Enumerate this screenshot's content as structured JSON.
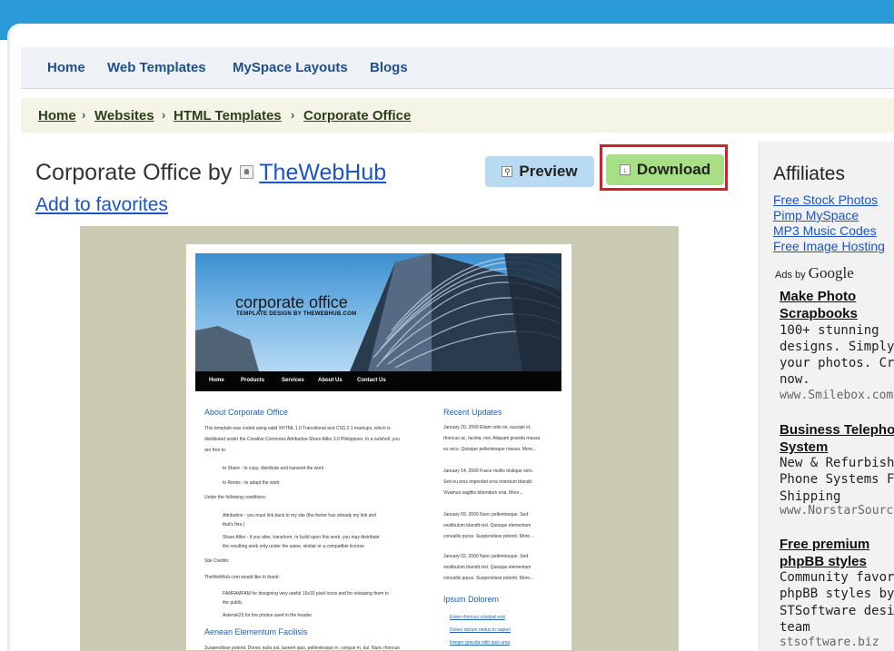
{
  "nav": {
    "items": [
      "Home",
      "Web Templates",
      "MySpace Layouts",
      "Blogs"
    ]
  },
  "breadcrumb": {
    "items": [
      "Home",
      "Websites",
      "HTML Templates",
      "Corporate Office"
    ],
    "separator": "›"
  },
  "page": {
    "title_prefix": "Corporate Office by",
    "author": "TheWebHub",
    "favorites": "Add to favorites",
    "preview_label": "Preview",
    "download_label": "Download"
  },
  "preview": {
    "banner_title": "corporate office",
    "banner_sub": "TEMPLATE DESIGN BY THEWEBHUB.COM",
    "menu": [
      "Home",
      "Products",
      "Services",
      "About Us",
      "Contact Us"
    ],
    "about_heading": "About Corporate Office",
    "about_lines": [
      "This template was coded using valid XHTML 1.0 Transitional and CSS 2.1 markups, which is",
      "distributed under the Creative Commons Attribution-Share Alike 3.0 Philippines. In a nutshell, you",
      "are free to:"
    ],
    "share": "to Share - to copy, distribute and transmit the work",
    "remix": "to Remix - to adapt the work",
    "conditions": "Under the following conditions:",
    "attribution": [
      "Attribution - you must link back to my site (the footer has already my link and",
      "that's fine.)"
    ],
    "sharealike": [
      "Share Alike - if you alter, transform, or build upon this work, you may distribute",
      "the resulting work only under the same, similar or a compatible license."
    ],
    "credits": "Site Credits:",
    "thanks": "TheWebHub.com would like to thank:",
    "famfamfam": [
      "FAMFAMFAM for designing very useful 16x16 pixel icons and for releasing them to",
      "the public."
    ],
    "asterisk": "Asterisk23 for the photos used in the header.",
    "aenean_heading": "Aenean Elementum Facilisis",
    "aenean_line": "Suspendisse potenti. Donec nulla est, laoreet quis, pellentesque in, congue in, dui. Nunc rhoncus",
    "updates_heading": "Recent Updates",
    "updates": [
      [
        "January 20, 2009 Etiam odio mi, suscipit et,",
        "rhoncus ac, lacinia, nisl. Aliquam gravida massa",
        "eu arcu. Quisque pellentesque massa. More..."
      ],
      [
        "January 14, 2009 Fusce mollis tristique sem.",
        "Sed eu eros imperdiet eros interdum blandit.",
        "Vivamus sagittis bibendum erat. More..."
      ],
      [
        "January 09, 2009 Nunc pellentesque. Sed",
        "vestibulum blandit nisl. Quisque elementum",
        "convallis purus. Suspendisse potenti. More..."
      ],
      [
        "January 02, 2009 Nunc pellentesque. Sed",
        "vestibulum blandit nisl. Quisque elementum",
        "convallis purus. Suspendisse potenti. More..."
      ]
    ],
    "ipsum_heading": "Ipsum Dolorem",
    "ipsum_links": [
      "Etiam rhoncus volutpat erat",
      "Donec dictum metus in sapien",
      "Integer gravida nibh quis urna"
    ]
  },
  "sidebar": {
    "title": "Affiliates",
    "affiliates": [
      "Free Stock Photos",
      "Pimp MySpace",
      "MP3 Music Codes",
      "Free Image Hosting"
    ],
    "ads_by": "Ads by",
    "google": "Google",
    "ads": [
      {
        "title": [
          "Make Photo",
          "Scrapbooks"
        ],
        "desc": [
          "100+ stunning",
          "designs. Simply add",
          "your photos. Create",
          "now."
        ],
        "url": "www.Smilebox.com"
      },
      {
        "title": [
          "Business Telephone",
          "System"
        ],
        "desc": [
          "New & Refurbished",
          "Phone Systems Free",
          "Shipping"
        ],
        "url": "www.NorstarSource"
      },
      {
        "title": [
          "Free premium",
          "phpBB styles"
        ],
        "desc": [
          "Community favorite",
          "phpBB styles by",
          "STSoftware designed",
          "team"
        ],
        "url": "stsoftware.biz"
      }
    ]
  },
  "colors": {
    "topbar": "#2a9ad8",
    "download": "#a6df84",
    "preview": "#b9dbf2",
    "highlight": "#d0202c",
    "link": "#1a55c8"
  }
}
